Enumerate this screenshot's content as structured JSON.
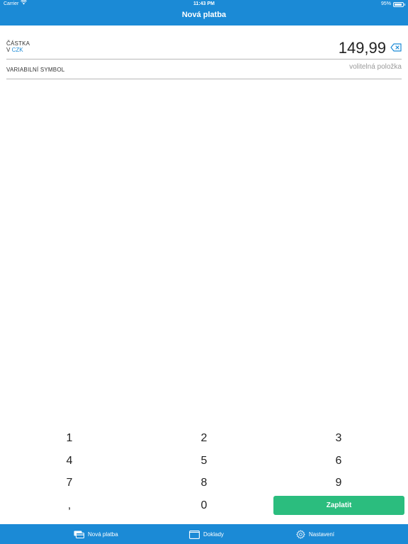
{
  "status_bar": {
    "carrier": "Carrier",
    "time": "11:43 PM",
    "battery_percent": "95%",
    "battery_level": 0.95
  },
  "nav": {
    "title": "Nová platba"
  },
  "amount": {
    "label": "ČÁSTKA",
    "currency_prefix": "V",
    "currency_code": "CZK",
    "value": "149,99"
  },
  "variable_symbol": {
    "label": "VARIABILNÍ SYMBOL",
    "placeholder": "volitelná položka",
    "value": ""
  },
  "keypad": {
    "keys": [
      "1",
      "2",
      "3",
      "4",
      "5",
      "6",
      "7",
      "8",
      "9",
      ",",
      "0"
    ],
    "pay_label": "Zaplatit"
  },
  "tabbar": {
    "tabs": [
      {
        "label": "Nová platba",
        "icon": "payment-cards-icon"
      },
      {
        "label": "Doklady",
        "icon": "receipts-icon"
      },
      {
        "label": "Nastavení",
        "icon": "gear-icon"
      }
    ]
  },
  "colors": {
    "primary": "#1b8ad6",
    "pay_button": "#2bbd7e",
    "accent_text": "#1b8ad6"
  }
}
